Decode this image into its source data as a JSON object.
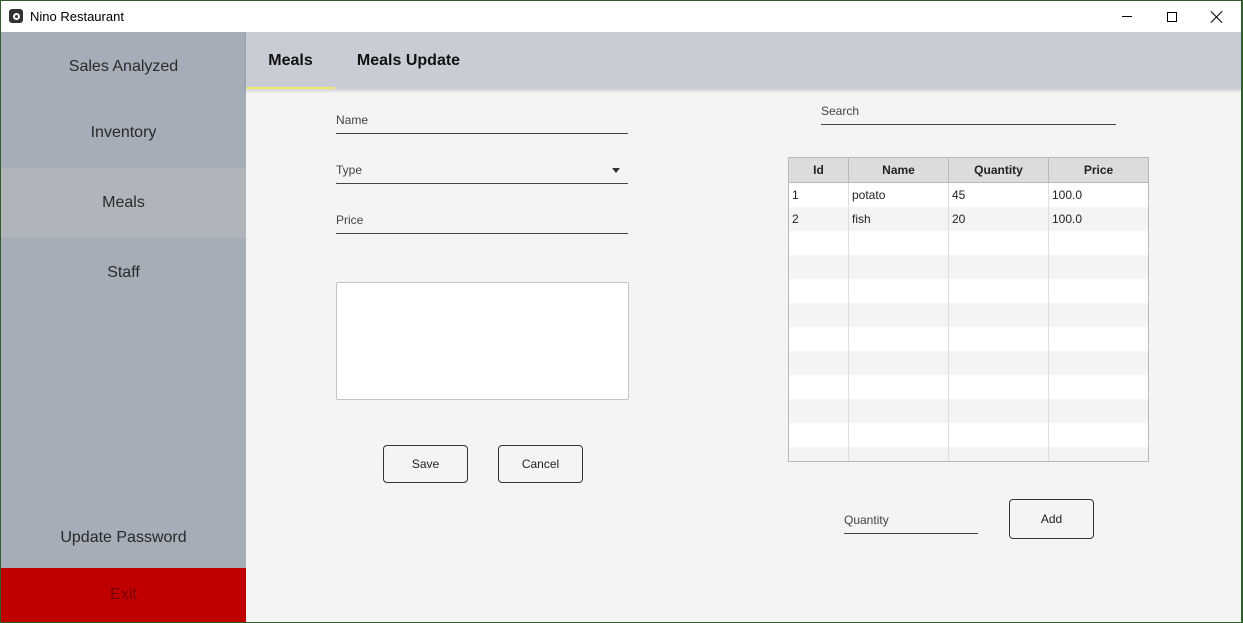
{
  "window": {
    "title": "Nino Restaurant"
  },
  "sidebar": {
    "items": [
      {
        "label": "Sales Analyzed"
      },
      {
        "label": "Inventory"
      },
      {
        "label": "Meals"
      },
      {
        "label": "Staff"
      }
    ],
    "update_password": "Update Password",
    "exit": "Exit"
  },
  "tabs": [
    {
      "label": "Meals"
    },
    {
      "label": "Meals Update"
    }
  ],
  "form": {
    "name_placeholder": "Name",
    "type_placeholder": "Type",
    "price_placeholder": "Price",
    "save_label": "Save",
    "cancel_label": "Cancel"
  },
  "search": {
    "placeholder": "Search"
  },
  "table": {
    "headers": [
      "Id",
      "Name",
      "Quantity",
      "Price"
    ],
    "rows": [
      [
        "1",
        "potato",
        "45",
        "100.0"
      ],
      [
        "2",
        "fish",
        "20",
        "100.0"
      ]
    ]
  },
  "quantity": {
    "placeholder": "Quantity"
  },
  "add_label": "Add",
  "colors": {
    "sidebar": "#a4adb8",
    "exit": "#c00000",
    "tab_underline": "#f2e86a"
  }
}
